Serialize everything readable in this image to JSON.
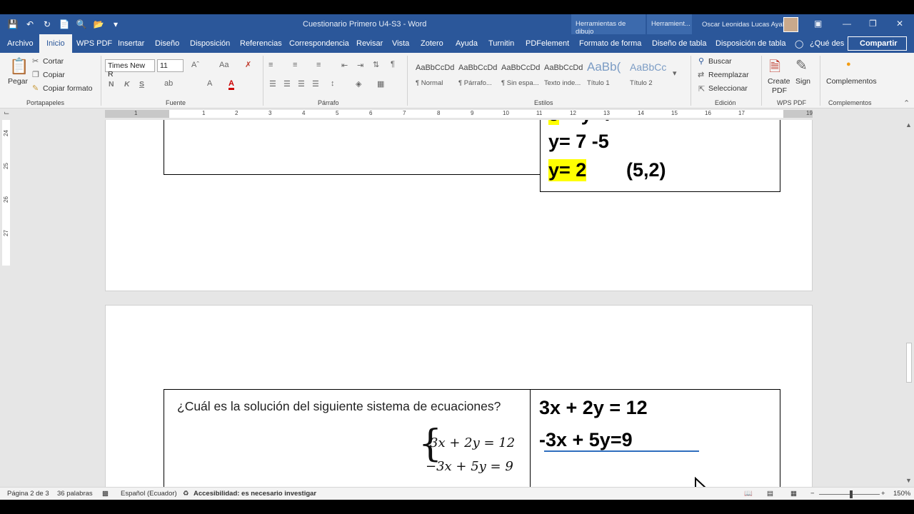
{
  "window": {
    "title": "Cuestionario Primero U4-S3  -  Word",
    "context_tabs": [
      "Herramientas de dibujo",
      "Herramient..."
    ],
    "user": "Oscar Leonidas Lucas Ayala"
  },
  "tabs": [
    "Archivo",
    "Inicio",
    "WPS PDF",
    "Insertar",
    "Diseño",
    "Disposición",
    "Referencias",
    "Correspondencia",
    "Revisar",
    "Vista",
    "Zotero",
    "Ayuda",
    "Turnitin",
    "PDFelement",
    "Formato de forma",
    "Diseño de tabla",
    "Disposición de tabla"
  ],
  "tell_me": "¿Qué des",
  "share": "Compartir",
  "ribbon": {
    "clipboard": {
      "paste": "Pegar",
      "cut": "Cortar",
      "copy": "Copiar",
      "format_painter": "Copiar formato",
      "label": "Portapapeles"
    },
    "font": {
      "name": "Times New R",
      "size": "11",
      "label": "Fuente",
      "bold": "N",
      "italic": "K",
      "underline": "S"
    },
    "paragraph": {
      "label": "Párrafo"
    },
    "styles": {
      "label": "Estilos",
      "items": [
        {
          "preview": "AaBbCcDd",
          "name": "¶ Normal"
        },
        {
          "preview": "AaBbCcDd",
          "name": "¶ Párrafo..."
        },
        {
          "preview": "AaBbCcDd",
          "name": "¶ Sin espa..."
        },
        {
          "preview": "AaBbCcDd",
          "name": "Texto inde..."
        },
        {
          "preview": "AaBb(",
          "name": "Título 1"
        },
        {
          "preview": "AaBbCc",
          "name": "Título 2"
        }
      ]
    },
    "editing": {
      "find": "Buscar",
      "replace": "Reemplazar",
      "select": "Seleccionar",
      "label": "Edición"
    },
    "wps": {
      "create": "Create",
      "pdf": "PDF",
      "sign": "Sign",
      "label": "WPS PDF"
    },
    "addins": {
      "name": "Complementos",
      "label": "Complementos"
    }
  },
  "ruler": {
    "h_numbers": [
      "1",
      "1",
      "2",
      "3",
      "4",
      "5",
      "6",
      "7",
      "8",
      "9",
      "10",
      "11",
      "12",
      "13",
      "14",
      "15",
      "16",
      "17",
      "19"
    ],
    "v_numbers": [
      "24",
      "25",
      "26",
      "27"
    ]
  },
  "document": {
    "page1_lines": [
      {
        "text": "y= 7 -5"
      },
      {
        "text": "y= 2",
        "extra": "(5,2)"
      }
    ],
    "page2": {
      "question": "¿Cuál es la solución del siguiente sistema de ecuaciones?",
      "eq1_math": "3x + 2y = 12",
      "eq2_math": "−3x + 5y = 9",
      "eq1_typed": "3x + 2y = 12",
      "eq2_typed": "-3x + 5y=9"
    }
  },
  "status": {
    "page": "Página 2 de 3",
    "words": "36 palabras",
    "language": "Español (Ecuador)",
    "accessibility": "Accesibilidad: es necesario investigar",
    "zoom": "150%"
  },
  "colors": {
    "accent": "#2b579a",
    "highlight": "#ffff00",
    "underline": "#2f6ebe"
  }
}
